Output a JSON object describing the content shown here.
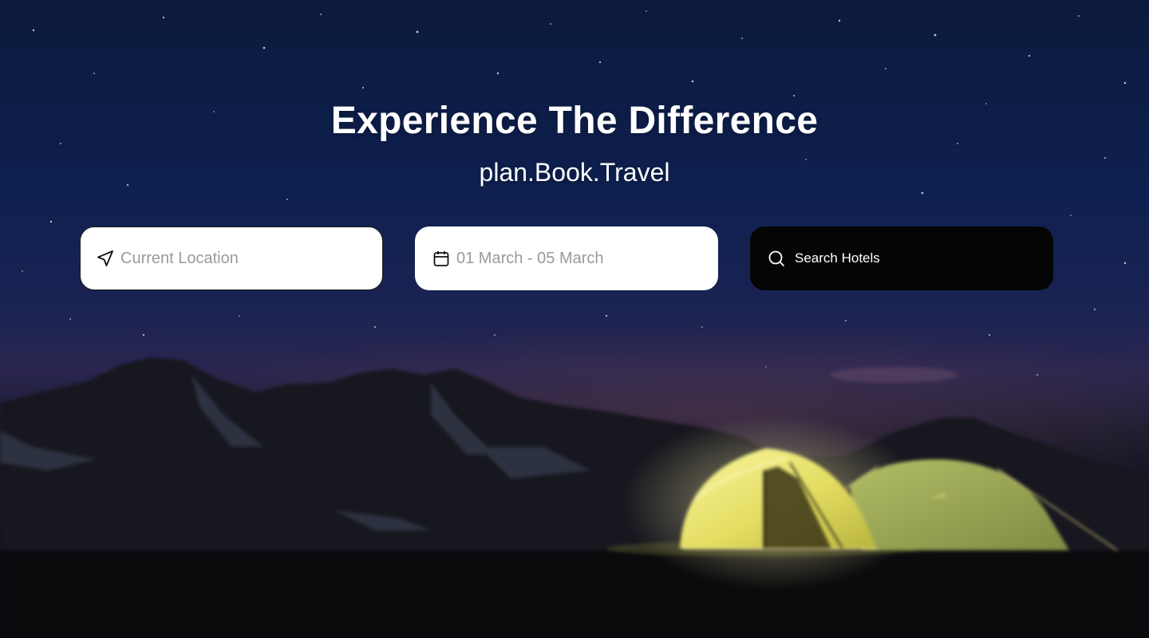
{
  "hero": {
    "headline": "Experience The Difference",
    "tagline": "plan.Book.Travel"
  },
  "search_form": {
    "location": {
      "placeholder": "Current Location",
      "value": "",
      "icon": "navigation-arrow-icon"
    },
    "dates": {
      "placeholder": "01 March - 05 March",
      "value": "",
      "icon": "calendar-icon"
    },
    "submit": {
      "label": "Search Hotels",
      "icon": "search-icon"
    }
  },
  "colors": {
    "sky_top": "#0c1a3c",
    "sky_mid": "#0e2050",
    "field_background": "#ffffff",
    "button_background": "#050505",
    "placeholder_text": "#9a9a9a",
    "heading_text": "#ffffff",
    "tent_glow": "#e6e27a",
    "tent_green": "#9caa55"
  }
}
